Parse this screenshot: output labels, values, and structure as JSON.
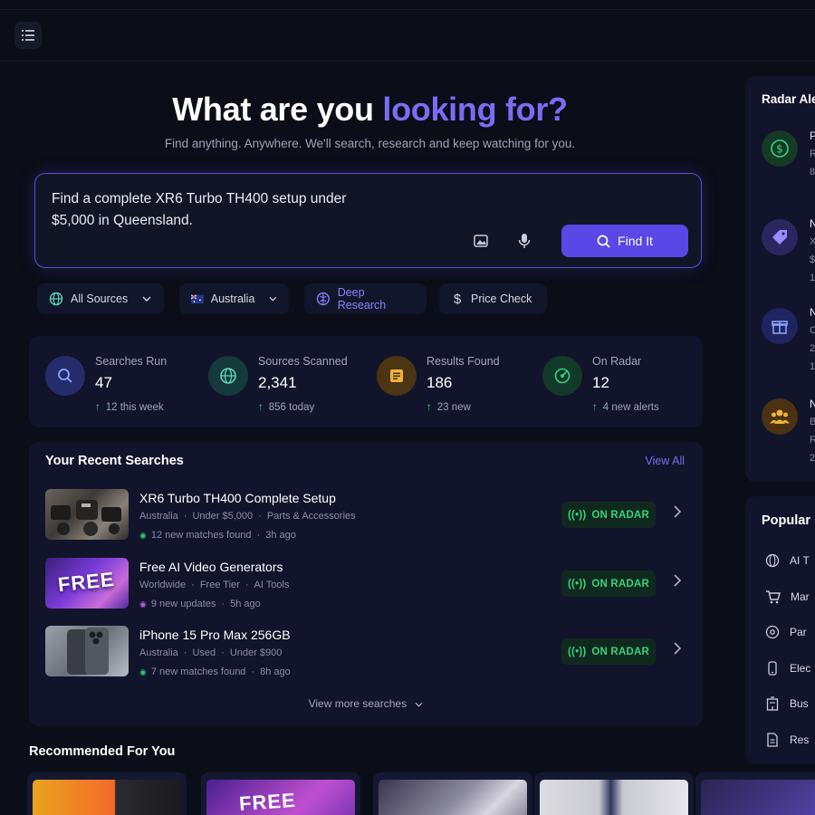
{
  "hero": {
    "title_plain": "What are you ",
    "title_accent": "looking for?",
    "subtitle": "Find anything. Anywhere. We'll search, research and keep watching for you."
  },
  "search": {
    "query": "Find a complete XR6 Turbo TH400 setup under $5,000 in Queensland.",
    "find_label": "Find It"
  },
  "filters": {
    "sources": "All Sources",
    "region": "Australia",
    "deep_research": "Deep Research",
    "price_check": "Price Check"
  },
  "stats": [
    {
      "label": "Searches Run",
      "value": "47",
      "delta": "12 this week",
      "icon": "search-icon",
      "color": "#2a2f6e"
    },
    {
      "label": "Sources Scanned",
      "value": "2,341",
      "delta": "856 today",
      "icon": "globe-icon",
      "color": "#143a3a"
    },
    {
      "label": "Results Found",
      "value": "186",
      "delta": "23 new",
      "icon": "document-icon",
      "color": "#4b3512"
    },
    {
      "label": "On Radar",
      "value": "12",
      "delta": "4 new alerts",
      "icon": "radar-icon",
      "color": "#12392a"
    }
  ],
  "recent": {
    "title": "Your Recent Searches",
    "view_all": "View All",
    "badge_label": "ON RADAR",
    "view_more": "View more searches",
    "items": [
      {
        "title": "XR6 Turbo TH400 Complete Setup",
        "meta": [
          "Australia",
          "Under $5,000",
          "Parts & Accessories"
        ],
        "updates": "12 new matches found",
        "time": "3h ago"
      },
      {
        "title": "Free AI Video Generators",
        "meta": [
          "Worldwide",
          "Free Tier",
          "AI Tools"
        ],
        "updates": "9 new updates",
        "time": "5h ago"
      },
      {
        "title": "iPhone 15 Pro Max 256GB",
        "meta": [
          "Australia",
          "Used",
          "Under $900"
        ],
        "updates": "7 new matches found",
        "time": "8h ago"
      }
    ]
  },
  "recommended": {
    "title": "Recommended For You",
    "card2_text": "FREE"
  },
  "radar_alerts": {
    "title": "Radar Ale",
    "items": [
      {
        "icon": "dollar-icon",
        "color": "#163a26",
        "lines": [
          "P",
          "R",
          "8"
        ]
      },
      {
        "icon": "tag-icon",
        "color": "#2c2660",
        "lines": [
          "N",
          "X",
          "$",
          "1"
        ]
      },
      {
        "icon": "gift-icon",
        "color": "#1f2560",
        "lines": [
          "N",
          "C",
          "2",
          "1"
        ]
      },
      {
        "icon": "users-icon",
        "color": "#4a3212",
        "lines": [
          "N",
          "B",
          "R",
          "2"
        ]
      }
    ]
  },
  "popular": {
    "title": "Popular",
    "items": [
      {
        "icon": "globe-icon",
        "label": "AI T"
      },
      {
        "icon": "cart-icon",
        "label": "Mar"
      },
      {
        "icon": "gear-icon",
        "label": "Par"
      },
      {
        "icon": "phone-icon",
        "label": "Elec"
      },
      {
        "icon": "building-icon",
        "label": "Bus"
      },
      {
        "icon": "document-icon",
        "label": "Res"
      }
    ]
  },
  "thumb_free_text": "FREE"
}
